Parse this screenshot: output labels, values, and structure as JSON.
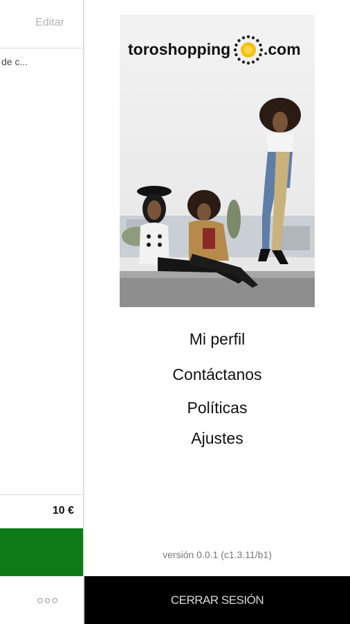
{
  "background_screen": {
    "edit_label": "Editar",
    "item_text": "de c...",
    "total": "10 €",
    "more_label": "○○○",
    "checkout_color": "#0c7a17"
  },
  "menu": {
    "brand": {
      "name_left": "toroshopping",
      "name_right": ".com",
      "sun_color": "#f4c20d"
    },
    "items": [
      {
        "label": "Mi perfil"
      },
      {
        "label": "Contáctanos"
      },
      {
        "label": "Políticas"
      },
      {
        "label": "Ajustes"
      }
    ],
    "version": "versión 0.0.1 (c1.3.11/b1)",
    "logout_label": "CERRAR SESIÓN"
  }
}
